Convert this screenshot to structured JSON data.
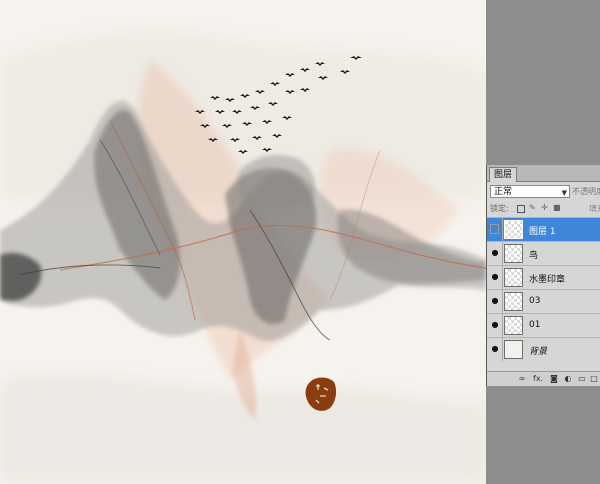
{
  "panel": {
    "tab_label": "图层",
    "blend_mode": "正常",
    "opacity_label": "不透明度",
    "lock_label": "锁定:",
    "fill_label": "填充"
  },
  "layers": [
    {
      "name": "图层 1",
      "selected": true,
      "visible": false
    },
    {
      "name": "鸟",
      "selected": false,
      "visible": true
    },
    {
      "name": "水墨印章",
      "selected": false,
      "visible": true
    },
    {
      "name": "03",
      "selected": false,
      "visible": true
    },
    {
      "name": "01",
      "selected": false,
      "visible": true
    },
    {
      "name": "背景",
      "selected": false,
      "visible": true
    }
  ],
  "footer": {
    "link_icon": "link-icon",
    "fx_label": "fx."
  },
  "colors": {
    "canvas_bg": "#f6f3ee",
    "selected_layer": "#3d86d9",
    "seal": "#8a3d10",
    "ink": "#2a2a2a",
    "rust": "#c66a46"
  }
}
